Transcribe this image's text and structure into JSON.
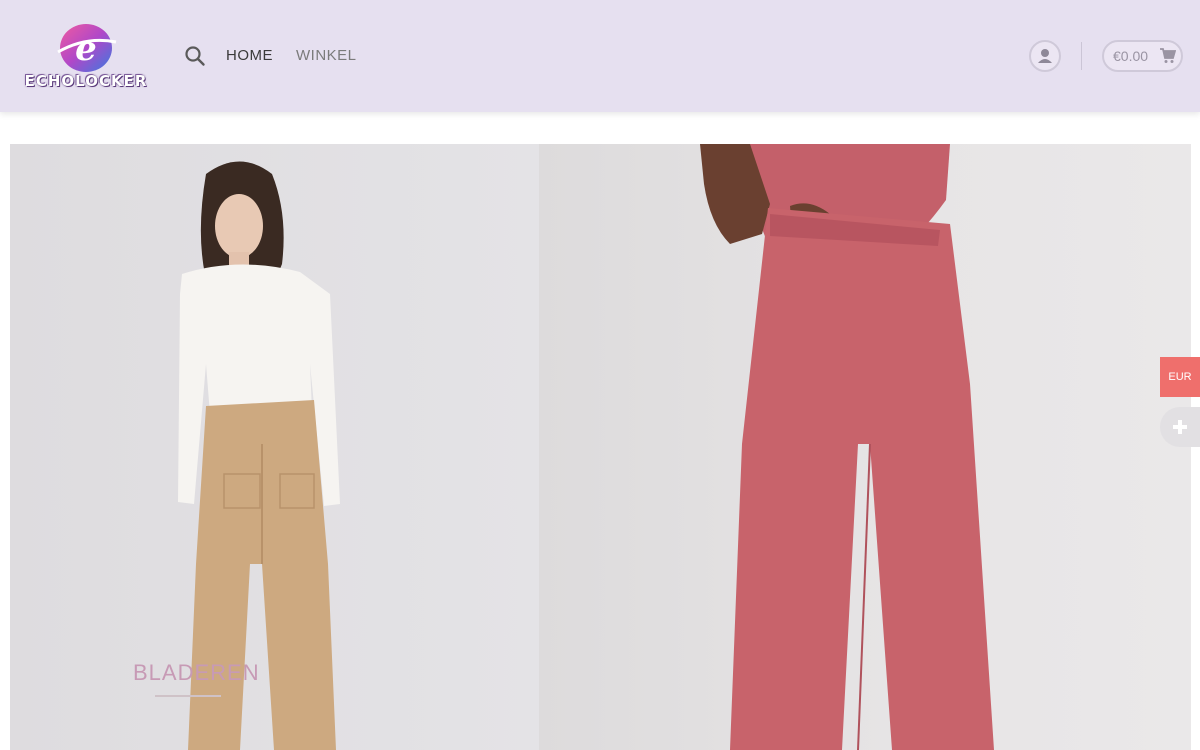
{
  "header": {
    "logo_text": "ECHOLOCKER",
    "nav": {
      "home_label": "HOME",
      "shop_label": "WINKEL"
    },
    "cart": {
      "amount": "€0.00"
    }
  },
  "hero": {
    "caption": "BLADEREN"
  },
  "side": {
    "currency_label": "EUR"
  },
  "icons": {
    "search": "search-icon",
    "account": "user-icon",
    "cart": "cart-icon",
    "expand": "plus-icon"
  },
  "colors": {
    "header_bg": "#e6e0f0",
    "currency_tab": "#ef6f6c",
    "caption": "#c79ab5",
    "pants_left": "#cda980",
    "pants_right": "#c8636b"
  }
}
